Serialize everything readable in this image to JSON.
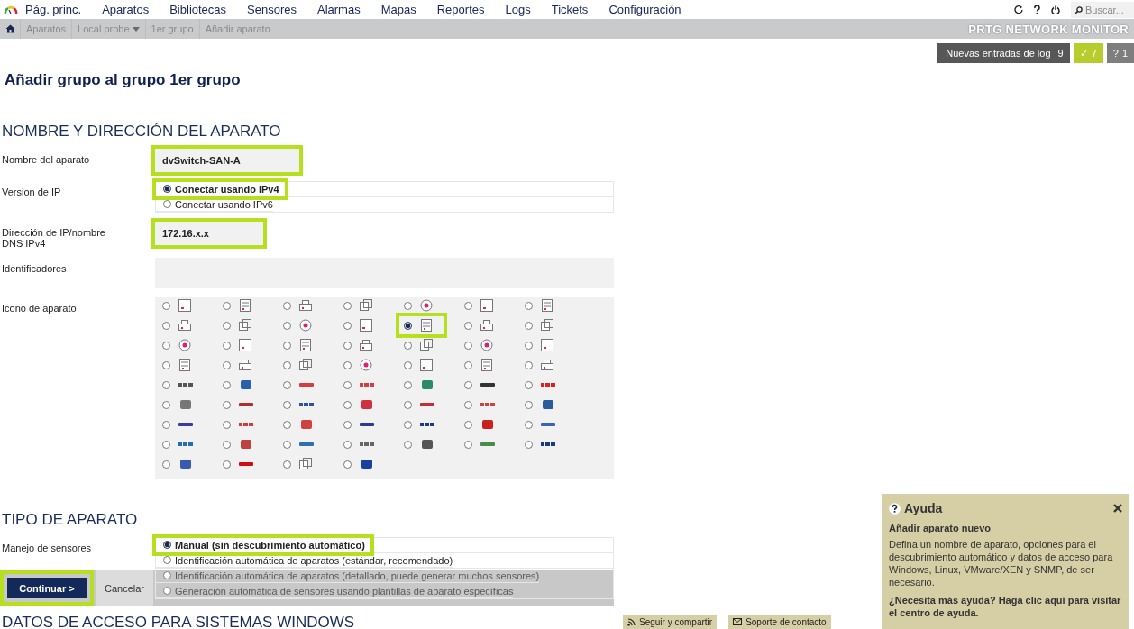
{
  "nav": {
    "items": [
      "Pág. princ.",
      "Aparatos",
      "Bibliotecas",
      "Sensores",
      "Alarmas",
      "Mapas",
      "Reportes",
      "Logs",
      "Tickets",
      "Configuración"
    ],
    "search": {
      "placeholder": "Buscar..."
    }
  },
  "breadcrumb": {
    "items": [
      {
        "label": "Aparatos",
        "dropdown": false
      },
      {
        "label": "Local probe",
        "dropdown": true
      },
      {
        "label": "1er grupo",
        "dropdown": false
      },
      {
        "label": "Añadir aparato",
        "dropdown": false
      }
    ],
    "brand": "PRTG NETWORK MONITOR"
  },
  "log_badge": {
    "label": "Nuevas entradas de log",
    "count": "9"
  },
  "status_badges": [
    {
      "kind": "ok",
      "icon": "✓",
      "count": "7"
    },
    {
      "kind": "unknown",
      "icon": "?",
      "count": "1"
    }
  ],
  "page_title": "Añadir grupo al grupo 1er grupo",
  "device_section": {
    "heading": "NOMBRE Y DIRECCIÓN DEL APARATO",
    "name": {
      "label": "Nombre del aparato",
      "value": "dvSwitch-SAN-A",
      "highlighted": true
    },
    "ip_version": {
      "label": "Version de IP",
      "options": [
        {
          "label": "Conectar usando IPv4",
          "selected": true,
          "highlighted": true
        },
        {
          "label": "Conectar usando IPv6",
          "selected": false,
          "highlighted": false
        }
      ]
    },
    "address": {
      "label": "Dirección de IP/nombre DNS IPv4",
      "value": "172.16.x.x",
      "highlighted": true
    },
    "tags": {
      "label": "Identificadores"
    },
    "icon": {
      "label": "Icono de aparato",
      "options": [
        {
          "kind": "device",
          "selected": false,
          "highlighted": false
        },
        {
          "kind": "device",
          "selected": false,
          "highlighted": false
        },
        {
          "kind": "device",
          "selected": false,
          "highlighted": false
        },
        {
          "kind": "device",
          "selected": false,
          "highlighted": false
        },
        {
          "kind": "device",
          "selected": false,
          "highlighted": false
        },
        {
          "kind": "device",
          "selected": false,
          "highlighted": false
        },
        {
          "kind": "device",
          "selected": false,
          "highlighted": false
        },
        {
          "kind": "device",
          "selected": false,
          "highlighted": false
        },
        {
          "kind": "device",
          "selected": false,
          "highlighted": false
        },
        {
          "kind": "device",
          "selected": false,
          "highlighted": false
        },
        {
          "kind": "device",
          "selected": false,
          "highlighted": false
        },
        {
          "kind": "device",
          "selected": true,
          "highlighted": true
        },
        {
          "kind": "device",
          "selected": false,
          "highlighted": false
        },
        {
          "kind": "device",
          "selected": false,
          "highlighted": false
        },
        {
          "kind": "device",
          "selected": false,
          "highlighted": false
        },
        {
          "kind": "device",
          "selected": false,
          "highlighted": false
        },
        {
          "kind": "device",
          "selected": false,
          "highlighted": false
        },
        {
          "kind": "device",
          "selected": false,
          "highlighted": false
        },
        {
          "kind": "device",
          "selected": false,
          "highlighted": false
        },
        {
          "kind": "device",
          "selected": false,
          "highlighted": false
        },
        {
          "kind": "device",
          "selected": false,
          "highlighted": false
        },
        {
          "kind": "device",
          "selected": false,
          "highlighted": false
        },
        {
          "kind": "device",
          "selected": false,
          "highlighted": false
        },
        {
          "kind": "device",
          "selected": false,
          "highlighted": false
        },
        {
          "kind": "device",
          "selected": false,
          "highlighted": false
        },
        {
          "kind": "device",
          "selected": false,
          "highlighted": false
        },
        {
          "kind": "device",
          "selected": false,
          "highlighted": false
        },
        {
          "kind": "device",
          "selected": false,
          "highlighted": false
        },
        {
          "kind": "logo",
          "selected": false,
          "highlighted": false
        },
        {
          "kind": "logo",
          "selected": false,
          "highlighted": false
        },
        {
          "kind": "logo",
          "selected": false,
          "highlighted": false
        },
        {
          "kind": "logo",
          "selected": false,
          "highlighted": false
        },
        {
          "kind": "logo",
          "selected": false,
          "highlighted": false
        },
        {
          "kind": "logo",
          "selected": false,
          "highlighted": false
        },
        {
          "kind": "logo",
          "selected": false,
          "highlighted": false
        },
        {
          "kind": "logo",
          "selected": false,
          "highlighted": false
        },
        {
          "kind": "logo",
          "selected": false,
          "highlighted": false
        },
        {
          "kind": "logo",
          "selected": false,
          "highlighted": false
        },
        {
          "kind": "logo",
          "selected": false,
          "highlighted": false
        },
        {
          "kind": "logo",
          "selected": false,
          "highlighted": false
        },
        {
          "kind": "logo",
          "selected": false,
          "highlighted": false
        },
        {
          "kind": "logo",
          "selected": false,
          "highlighted": false
        },
        {
          "kind": "logo",
          "selected": false,
          "highlighted": false
        },
        {
          "kind": "logo",
          "selected": false,
          "highlighted": false
        },
        {
          "kind": "logo",
          "selected": false,
          "highlighted": false
        },
        {
          "kind": "logo",
          "selected": false,
          "highlighted": false
        },
        {
          "kind": "logo",
          "selected": false,
          "highlighted": false
        },
        {
          "kind": "logo",
          "selected": false,
          "highlighted": false
        },
        {
          "kind": "logo",
          "selected": false,
          "highlighted": false
        },
        {
          "kind": "logo",
          "selected": false,
          "highlighted": false
        },
        {
          "kind": "logo",
          "selected": false,
          "highlighted": false
        },
        {
          "kind": "logo",
          "selected": false,
          "highlighted": false
        },
        {
          "kind": "logo",
          "selected": false,
          "highlighted": false
        },
        {
          "kind": "logo",
          "selected": false,
          "highlighted": false
        },
        {
          "kind": "logo",
          "selected": false,
          "highlighted": false
        },
        {
          "kind": "logo",
          "selected": false,
          "highlighted": false
        },
        {
          "kind": "logo",
          "selected": false,
          "highlighted": false
        },
        {
          "kind": "logo",
          "selected": false,
          "highlighted": false
        },
        {
          "kind": "device",
          "selected": false,
          "highlighted": false
        },
        {
          "kind": "logo",
          "selected": false,
          "highlighted": false
        }
      ]
    }
  },
  "type_section": {
    "heading": "TIPO DE APARATO",
    "sensor_management": {
      "label": "Manejo de sensores",
      "options": [
        {
          "label": "Manual (sin descubrimiento automático)",
          "selected": true,
          "highlighted": true
        },
        {
          "label": "Identificación automática de aparatos (estándar, recomendado)",
          "selected": false,
          "highlighted": false
        },
        {
          "label": "Identificación automática de aparatos (detallado, puede generar muchos sensores)",
          "selected": false,
          "highlighted": false
        },
        {
          "label": "Generación automática de sensores usando plantillas de aparato específicas",
          "selected": false,
          "highlighted": false
        }
      ]
    }
  },
  "actions": [
    {
      "label": "Continuar >",
      "kind": "primary",
      "highlighted": true
    },
    {
      "label": "Cancelar",
      "kind": "secondary",
      "highlighted": false
    }
  ],
  "next_section_heading": "DATOS DE ACCESO PARA SISTEMAS WINDOWS",
  "footer_links": [
    {
      "kind": "rss",
      "label": "Seguir y compartir"
    },
    {
      "kind": "mail",
      "label": "Soporte de contacto"
    }
  ],
  "help": {
    "title": "Ayuda",
    "heading": "Añadir aparato nuevo",
    "text": "Defina un nombre de aparato, opciones para el descubrimiento automático y datos de acceso para Windows, Linux, VMware/XEN y SNMP, de ser necesario.",
    "more": "¿Necesita más ayuda? Haga clic aquí para visitar el centro de ayuda."
  }
}
